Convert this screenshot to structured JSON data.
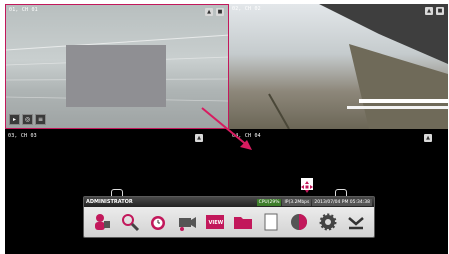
{
  "tiles": [
    {
      "label": "01, CH 01"
    },
    {
      "label": "02, CH 02"
    },
    {
      "label": "03, CH 03"
    },
    {
      "label": "04, CH 04"
    }
  ],
  "toolbar": {
    "title": "ADMINISTRATOR",
    "cpu": "CPU(29%",
    "network": "IP(3.2Mbps",
    "datetime": "2013/07/04 PM 05:34:38",
    "view_label": "VIEW",
    "buttons": [
      {
        "icon": "user-login-icon"
      },
      {
        "icon": "search-icon"
      },
      {
        "icon": "alarm-clock-icon"
      },
      {
        "icon": "video-record-icon"
      },
      {
        "icon": "view-layout-icon"
      },
      {
        "icon": "folder-icon"
      },
      {
        "icon": "blank-document-icon"
      },
      {
        "icon": "info-icon"
      },
      {
        "icon": "settings-icon"
      },
      {
        "icon": "collapse-icon"
      }
    ]
  },
  "colors": {
    "selected_border": "#c2185b",
    "arrow": "#d81b60",
    "cpu_badge": "#3d7d2a"
  }
}
